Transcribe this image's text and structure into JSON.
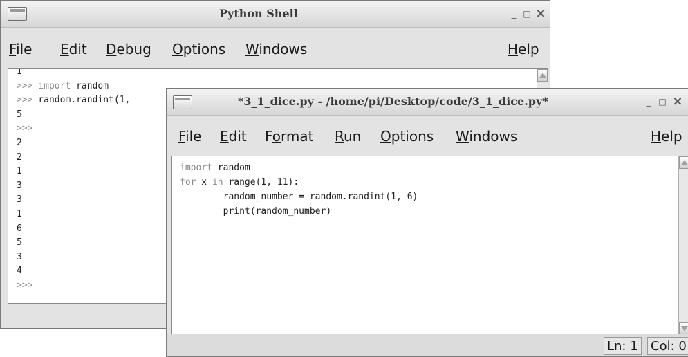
{
  "shell": {
    "title": "Python Shell",
    "controls": {
      "minimize": "_",
      "maximize": "□",
      "close": "×"
    },
    "menu": [
      {
        "mnemonic": "F",
        "rest": "ile"
      },
      {
        "mnemonic": "E",
        "rest": "dit"
      },
      {
        "mnemonic": "D",
        "rest": "ebug"
      },
      {
        "mnemonic": "O",
        "rest": "ptions"
      },
      {
        "mnemonic": "W",
        "rest": "indows"
      }
    ],
    "help": {
      "mnemonic": "H",
      "rest": "elp"
    },
    "lines": [
      {
        "prompt": "",
        "kw": "",
        "text": "1"
      },
      {
        "prompt": ">>> ",
        "kw": "import",
        "text": " random"
      },
      {
        "prompt": ">>> ",
        "kw": "",
        "text": "random.randint(1,"
      },
      {
        "prompt": "",
        "kw": "",
        "text": "5"
      },
      {
        "prompt": ">>>",
        "kw": "",
        "text": ""
      },
      {
        "prompt": "",
        "kw": "",
        "text": "2"
      },
      {
        "prompt": "",
        "kw": "",
        "text": "2"
      },
      {
        "prompt": "",
        "kw": "",
        "text": "1"
      },
      {
        "prompt": "",
        "kw": "",
        "text": "3"
      },
      {
        "prompt": "",
        "kw": "",
        "text": "3"
      },
      {
        "prompt": "",
        "kw": "",
        "text": "1"
      },
      {
        "prompt": "",
        "kw": "",
        "text": "6"
      },
      {
        "prompt": "",
        "kw": "",
        "text": "5"
      },
      {
        "prompt": "",
        "kw": "",
        "text": "3"
      },
      {
        "prompt": "",
        "kw": "",
        "text": "4"
      },
      {
        "prompt": ">>>",
        "kw": "",
        "text": ""
      }
    ]
  },
  "editor": {
    "title": "*3_1_dice.py - /home/pi/Desktop/code/3_1_dice.py*",
    "controls": {
      "minimize": "_",
      "maximize": "□",
      "close": "×"
    },
    "menu": [
      {
        "mnemonic": "F",
        "rest": "ile",
        "pre": ""
      },
      {
        "mnemonic": "E",
        "rest": "dit",
        "pre": ""
      },
      {
        "mnemonic": "o",
        "rest": "rmat",
        "pre": "F"
      },
      {
        "mnemonic": "R",
        "rest": "un",
        "pre": ""
      },
      {
        "mnemonic": "O",
        "rest": "ptions",
        "pre": ""
      },
      {
        "mnemonic": "W",
        "rest": "indows",
        "pre": ""
      }
    ],
    "help": {
      "mnemonic": "H",
      "rest": "elp"
    },
    "code": [
      {
        "kw": "import",
        "text": " random"
      },
      {
        "kw": "for",
        "text": " x ",
        "kw2": "in",
        "text2": " range(1, 11):"
      },
      {
        "kw": "",
        "text": "        random_number = random.randint(1, 6)"
      },
      {
        "kw": "",
        "text": "        print(random_number)"
      }
    ],
    "status": {
      "line": "Ln: 1",
      "col": "Col: 0"
    }
  }
}
